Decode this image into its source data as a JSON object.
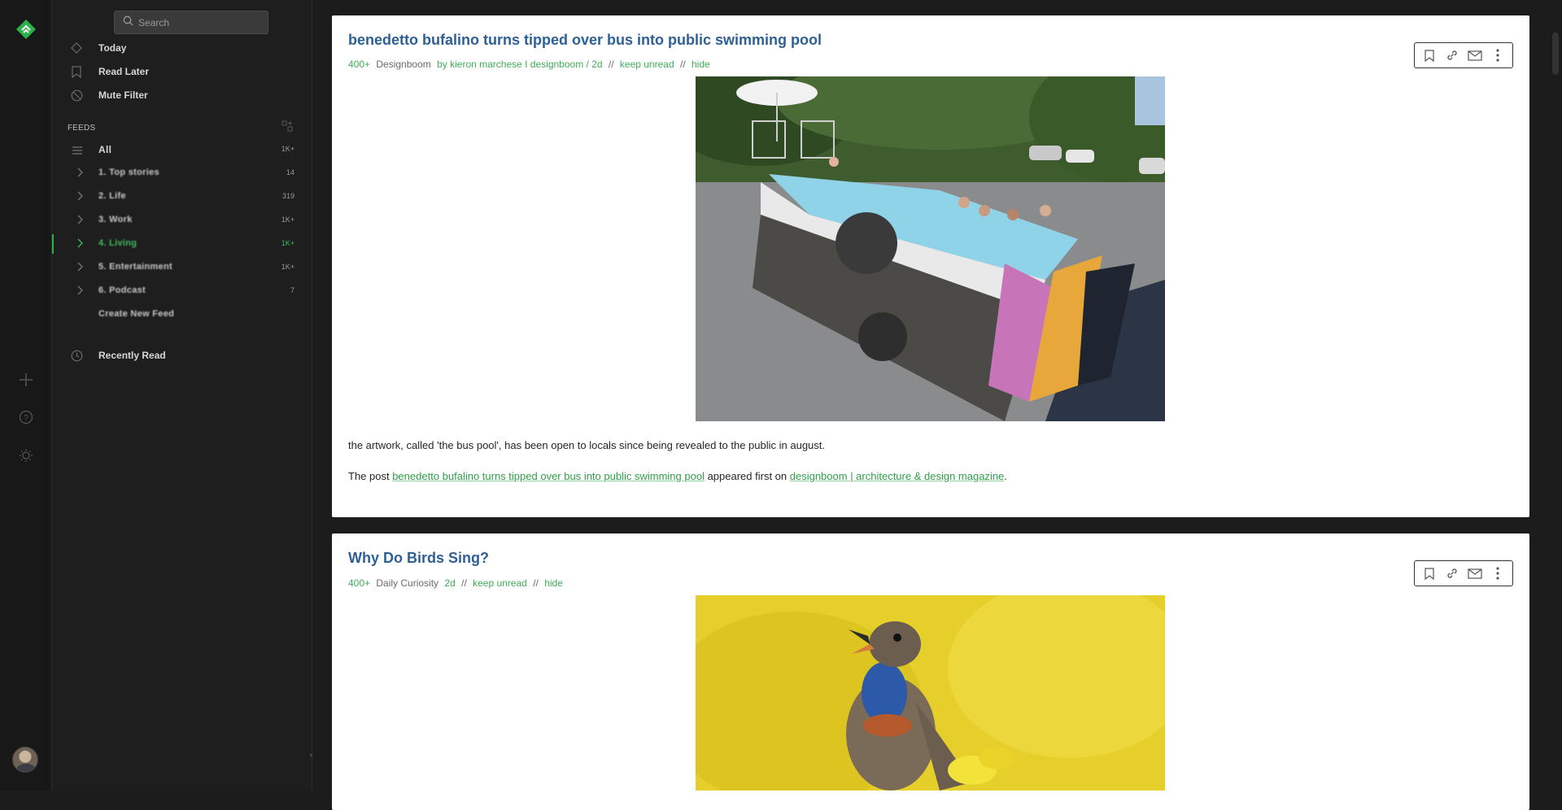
{
  "search": {
    "placeholder": "Search"
  },
  "nav": {
    "today": "Today",
    "read_later": "Read Later",
    "mute_filter": "Mute Filter",
    "recently_read": "Recently Read"
  },
  "feeds": {
    "header": "FEEDS",
    "all": {
      "label": "All",
      "count": "1K+"
    },
    "items": [
      {
        "label": "1. Top stories",
        "count": "14"
      },
      {
        "label": "2. Life",
        "count": "319"
      },
      {
        "label": "3. Work",
        "count": "1K+"
      },
      {
        "label": "4. Living",
        "count": "1K+",
        "active": true
      },
      {
        "label": "5. Entertainment",
        "count": "1K+"
      },
      {
        "label": "6. Podcast",
        "count": "7"
      },
      {
        "label": "Create New Feed",
        "count": ""
      }
    ]
  },
  "articles": [
    {
      "title": "benedetto bufalino turns tipped over bus into public swimming pool",
      "count": "400+",
      "source": "Designboom",
      "byline": "by kieron marchese I designboom / 2d",
      "keep_unread": "keep unread",
      "hide": "hide",
      "sep": "//",
      "paragraph1": "the artwork, called 'the bus pool', has been open to locals since being revealed to the public in august.",
      "p2_prefix": "The post ",
      "p2_link1": "benedetto bufalino turns tipped over bus into public swimming pool",
      "p2_middle": " appeared first on ",
      "p2_link2": "designboom | architecture & design magazine",
      "p2_suffix": "."
    },
    {
      "title": "Why Do Birds Sing?",
      "count": "400+",
      "source": "Daily Curiosity",
      "byline": "2d",
      "keep_unread": "keep unread",
      "hide": "hide",
      "sep": "//"
    }
  ],
  "colors": {
    "accent": "#2bb24c",
    "title": "#2e5f96",
    "bg": "#1c1c1c"
  }
}
